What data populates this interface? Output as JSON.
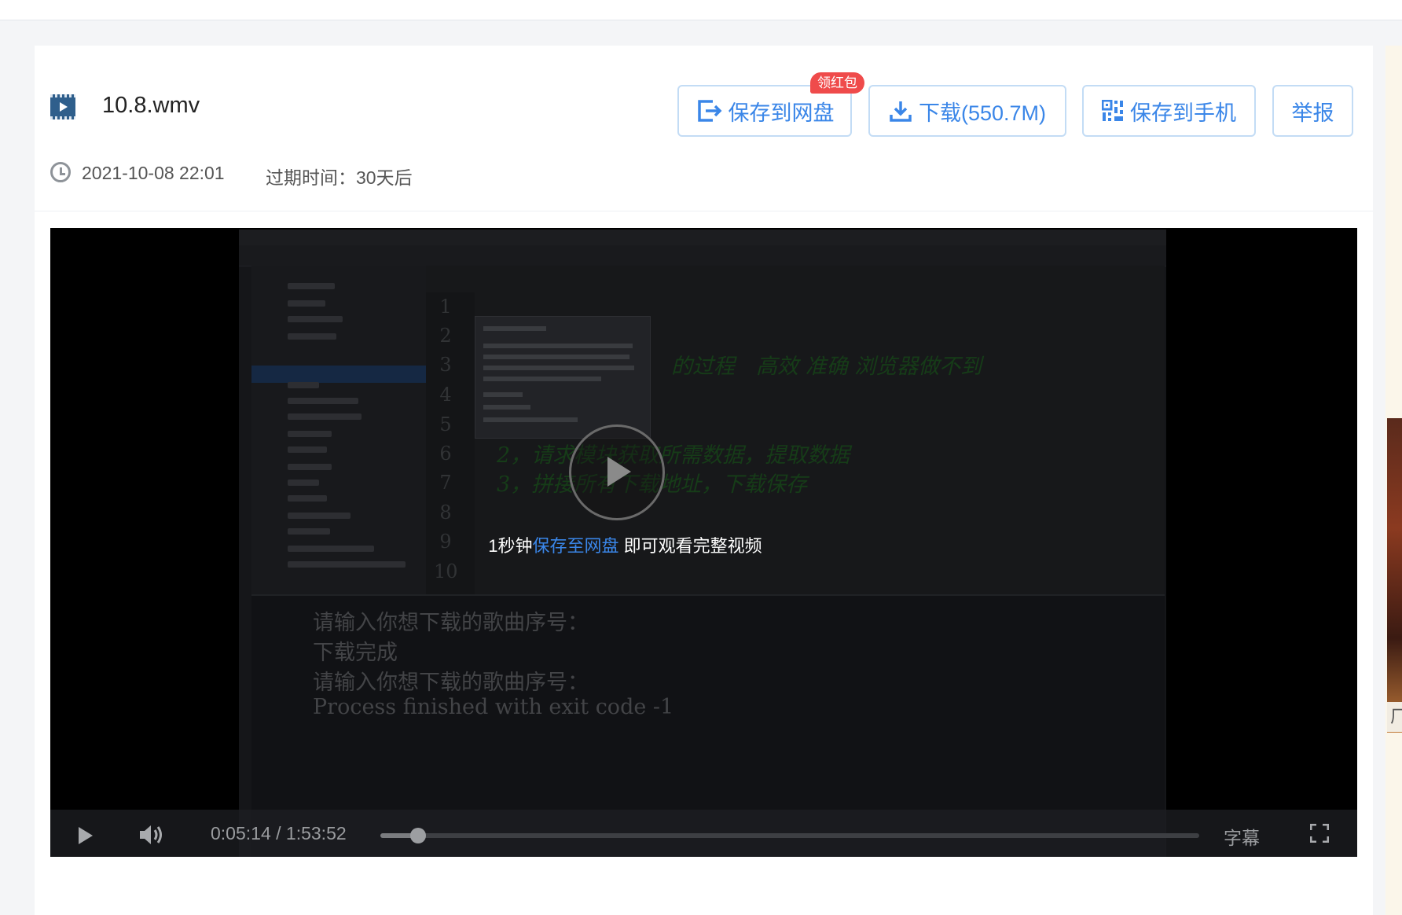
{
  "file": {
    "name": "10.8.wmv",
    "icon": "video-file-icon",
    "date": "2021-10-08 22:01",
    "expire": "过期时间：30天后"
  },
  "actions": {
    "save_label": "保存到网盘",
    "badge": "领红包",
    "download_label": "下载(550.7M)",
    "phone_label": "保存到手机",
    "report_label": "举报"
  },
  "player": {
    "overlay_prefix": "1秒钟",
    "overlay_link": "保存至网盘",
    "overlay_suffix": " 即可观看完整视频",
    "current_time": "0:05:14",
    "time_separator": "/",
    "total_time": "1:53:52",
    "progress": 0.046,
    "subtitle_label": "字幕"
  },
  "video_frame": {
    "line_numbers": [
      "1",
      "2",
      "3",
      "4",
      "5",
      "6",
      "7",
      "8",
      "9",
      "10"
    ],
    "code_lines": [
      "的过程　高效 准确 浏览器做不到",
      "2，请求模块获取所需数据，提取数据",
      "3，拼接所有下载地址，下载保存"
    ],
    "run_output": [
      "请输入你想下载的歌曲序号：",
      "下载完成",
      "请输入你想下载的歌曲序号：",
      "Process finished with exit code -1"
    ]
  },
  "colors": {
    "accent": "#3a86e8",
    "badge": "#ef4b4b",
    "border": "#c3dcf5"
  },
  "side_thumb_caption": "厂"
}
